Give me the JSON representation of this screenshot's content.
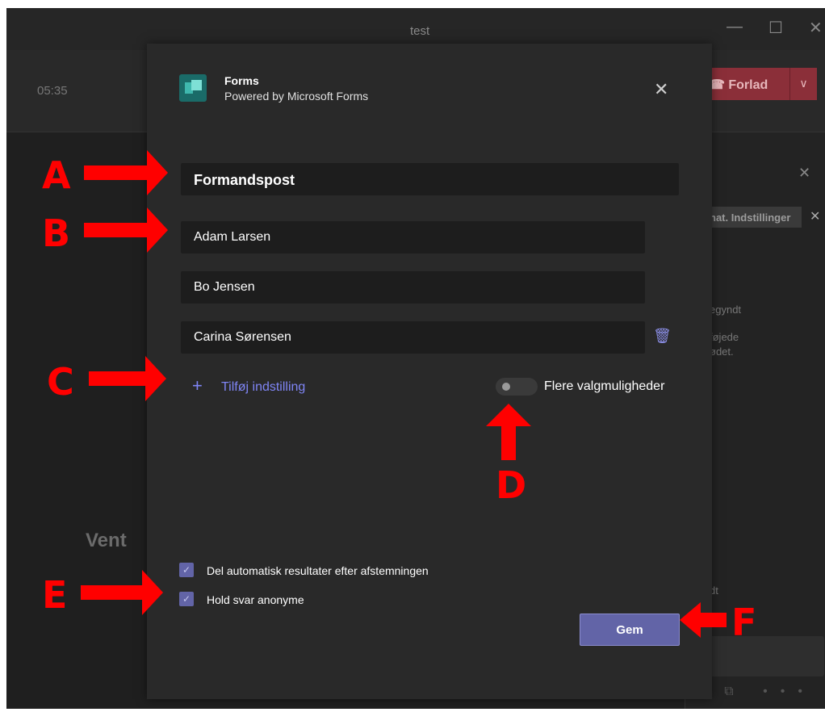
{
  "window": {
    "title": "test",
    "controls": [
      "—",
      "☐",
      "✕"
    ]
  },
  "meeting": {
    "timer": "05:35",
    "leave_label": "Forlad",
    "leave_dropdown": "∨"
  },
  "side_panel": {
    "close": "✕",
    "chip_label": "hat. Indstillinger",
    "chip_close": "✕",
    "text1": "egyndt",
    "text2": "føjede",
    "text3": "ødet.",
    "text4": "dt"
  },
  "background_text": "Vent",
  "bottom_icons": "⟋ ! ⊘ ☺ ▭ ⧉ ••• ⊳",
  "dialog": {
    "app_name": "Forms",
    "app_subtitle": "Powered by Microsoft Forms",
    "close": "✕",
    "question": "Formandspost",
    "options": [
      "Adam Larsen",
      "Bo Jensen",
      "Carina Sørensen"
    ],
    "trash_icon": "🗑",
    "add_plus": "+",
    "add_option_label": "Tilføj indstilling",
    "multiple_choice_label": "Flere valgmuligheder",
    "multiple_choice_enabled": false,
    "checkbox_share_label": "Del automatisk resultater efter afstemningen",
    "checkbox_share_checked": true,
    "checkbox_anon_label": "Hold svar anonyme",
    "checkbox_anon_checked": true,
    "checkmark": "✓",
    "save_label": "Gem"
  },
  "annotations": {
    "a": "A",
    "b": "B",
    "c": "C",
    "d": "D",
    "e": "E",
    "f": "F"
  },
  "colors": {
    "accent": "#6264a7",
    "annotation": "#ff0000",
    "leave": "#8b2f39"
  }
}
